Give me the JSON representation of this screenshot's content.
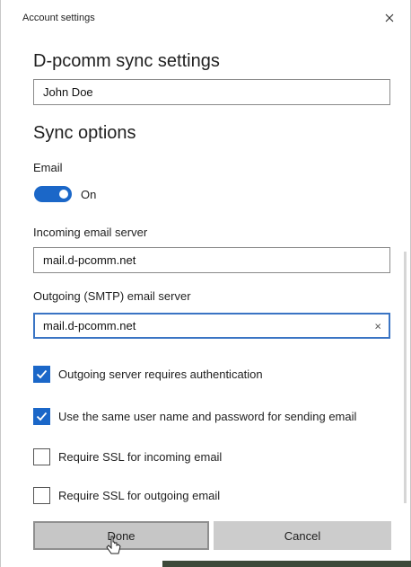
{
  "window": {
    "title": "Account settings",
    "close_label": "×"
  },
  "header": {
    "title": "D-pcomm sync settings"
  },
  "account_name": {
    "value": "John Doe"
  },
  "sync": {
    "title": "Sync options",
    "email_label": "Email",
    "email_toggle_state": "On"
  },
  "incoming": {
    "label": "Incoming email server",
    "value": "mail.d-pcomm.net"
  },
  "outgoing": {
    "label": "Outgoing (SMTP) email server",
    "value": "mail.d-pcomm.net",
    "clear_label": "×"
  },
  "options": [
    {
      "label": "Outgoing server requires authentication",
      "checked": true
    },
    {
      "label": "Use the same user name and password for sending email",
      "checked": true
    },
    {
      "label": "Require SSL for incoming email",
      "checked": false
    },
    {
      "label": "Require SSL for outgoing email",
      "checked": false
    }
  ],
  "buttons": {
    "done": "Done",
    "cancel": "Cancel"
  },
  "colors": {
    "accent": "#1b67c8",
    "focus_border": "#3a74c4"
  }
}
